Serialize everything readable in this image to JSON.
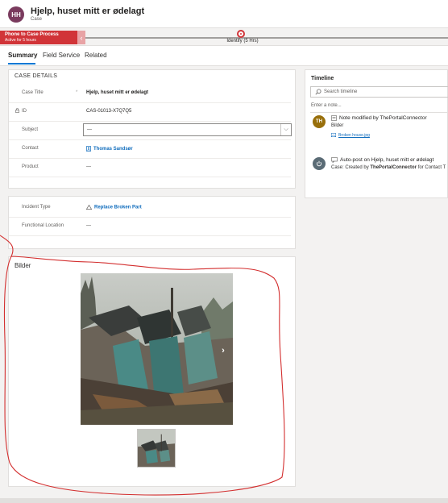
{
  "header": {
    "avatar_initials": "HH",
    "title": "Hjelp, huset mitt er ødelagt",
    "entity_type": "Case"
  },
  "process": {
    "stage_name": "Phone to Case Process",
    "stage_status": "Active for 5 hours",
    "current_stage": "Identify  (5 Hrs)"
  },
  "tabs": [
    {
      "label": "Summary"
    },
    {
      "label": "Field Service"
    },
    {
      "label": "Related"
    }
  ],
  "case_details": {
    "heading": "CASE DETAILS",
    "fields": [
      {
        "label": "Case Title",
        "value": "Hjelp, huset mitt er ødelagt"
      },
      {
        "label": "ID",
        "value": "CAS-01013-X7Q7Q5"
      },
      {
        "label": "Subject",
        "value": "---"
      },
      {
        "label": "Contact",
        "value": "Thomas Sandsør"
      },
      {
        "label": "Product",
        "value": "---"
      }
    ]
  },
  "incident": {
    "fields": [
      {
        "label": "Incident Type",
        "value": "Replace Broken Part"
      },
      {
        "label": "Functional Location",
        "value": "---"
      }
    ]
  },
  "images_section": {
    "heading": "Bilder"
  },
  "timeline": {
    "title": "Timeline",
    "search_placeholder": "Search timeline",
    "note_placeholder": "Enter a note...",
    "items": [
      {
        "avatar": "TH",
        "title": "Note modified by ThePortalConnector",
        "subtitle": "Bilder",
        "attachment": "Broken house.jpg"
      },
      {
        "title": "Auto-post on Hjelp, huset mitt er ødelagt",
        "subtitle_prefix": "Case: Created by ",
        "subtitle_bold": "ThePortalConnector",
        "subtitle_suffix": " for Contact T"
      }
    ]
  },
  "colors": {
    "accent": "#0078d4",
    "stage": "#d13438",
    "avatar": "#7a3b5e",
    "annotation": "#d32f2f"
  }
}
